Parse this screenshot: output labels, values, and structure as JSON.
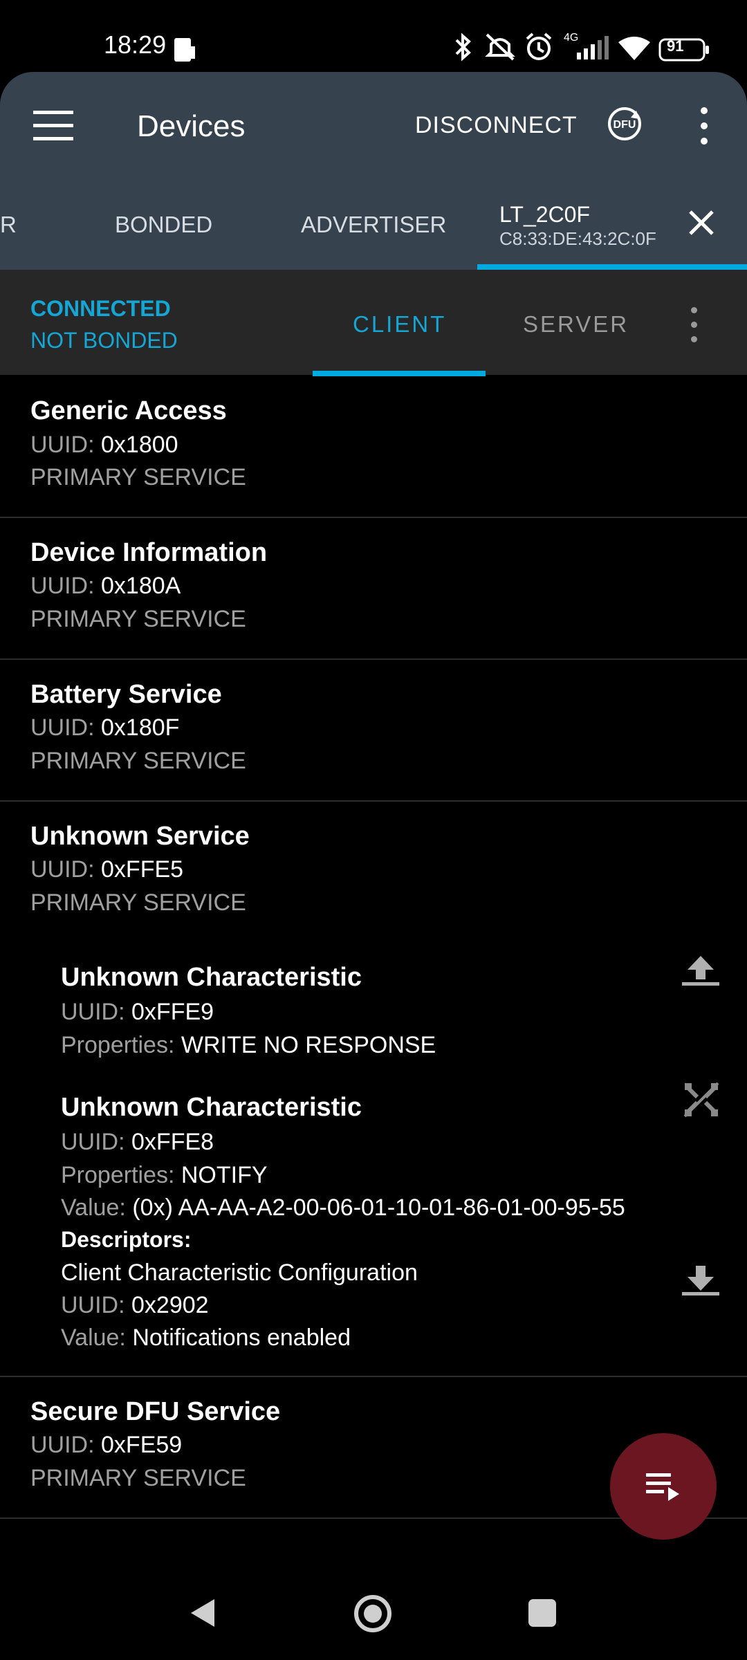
{
  "status_bar": {
    "time": "18:29",
    "network": "4G",
    "battery": "91",
    "icons": [
      "phone-card-icon",
      "bluetooth-icon",
      "mute-icon",
      "alarm-icon",
      "signal-icon",
      "wifi-icon",
      "battery-icon"
    ]
  },
  "app_bar": {
    "title": "Devices",
    "disconnect_label": "DISCONNECT",
    "dfu_label": "DFU"
  },
  "top_tabs": {
    "partial_label": "R",
    "bonded": "BONDED",
    "advertiser": "ADVERTISER",
    "device_name": "LT_2C0F",
    "device_address": "C8:33:DE:43:2C:0F"
  },
  "connection": {
    "status": "CONNECTED",
    "bond": "NOT BONDED",
    "tab_client": "CLIENT",
    "tab_server": "SERVER"
  },
  "labels": {
    "uuid": "UUID:",
    "properties": "Properties:",
    "value": "Value:",
    "descriptors": "Descriptors:"
  },
  "services": [
    {
      "name": "Generic Access",
      "uuid": "0x1800",
      "type": "PRIMARY SERVICE"
    },
    {
      "name": "Device Information",
      "uuid": "0x180A",
      "type": "PRIMARY SERVICE"
    },
    {
      "name": "Battery Service",
      "uuid": "0x180F",
      "type": "PRIMARY SERVICE"
    },
    {
      "name": "Unknown Service",
      "uuid": "0xFFE5",
      "type": "PRIMARY SERVICE"
    },
    {
      "name": "Secure DFU Service",
      "uuid": "0xFE59",
      "type": "PRIMARY SERVICE"
    }
  ],
  "characteristics": [
    {
      "name": "Unknown Characteristic",
      "uuid": "0xFFE9",
      "properties": "WRITE NO RESPONSE"
    },
    {
      "name": "Unknown Characteristic",
      "uuid": "0xFFE8",
      "properties": "NOTIFY",
      "value": "(0x) AA-AA-A2-00-06-01-10-01-86-01-00-95-55"
    }
  ],
  "descriptor": {
    "name": "Client Characteristic Configuration",
    "uuid": "0x2902",
    "value": "Notifications enabled"
  },
  "colors": {
    "app_bar": "#36434f",
    "accent": "#00a9e0",
    "fab": "#6c1622",
    "subheader": "#272727"
  }
}
